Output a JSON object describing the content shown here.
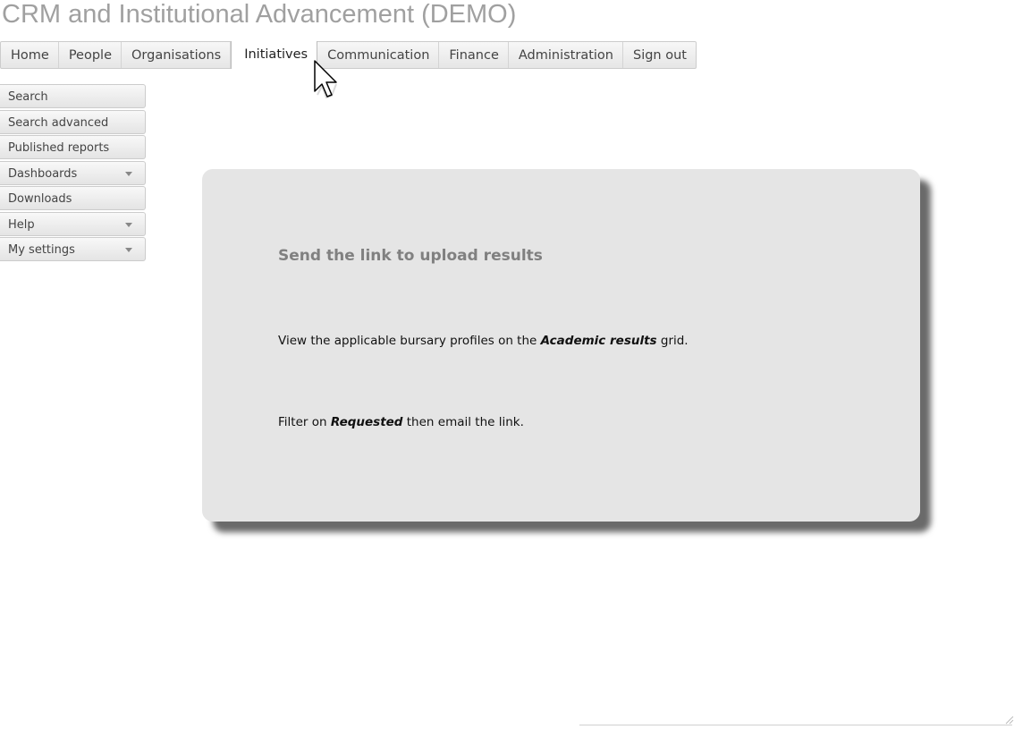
{
  "app": {
    "title": "CRM and Institutional Advancement (DEMO)"
  },
  "topnav": {
    "items": [
      {
        "label": "Home"
      },
      {
        "label": "People"
      },
      {
        "label": "Organisations"
      },
      {
        "label": "Initiatives",
        "active": true
      },
      {
        "label": "Communication"
      },
      {
        "label": "Finance"
      },
      {
        "label": "Administration"
      },
      {
        "label": "Sign out"
      }
    ]
  },
  "sidebar": {
    "items": [
      {
        "label": "Search"
      },
      {
        "label": "Search advanced"
      },
      {
        "label": "Published reports"
      },
      {
        "label": "Dashboards",
        "dropdown": true
      },
      {
        "label": "Downloads"
      },
      {
        "label": "Help",
        "dropdown": true
      },
      {
        "label": "My settings",
        "dropdown": true
      }
    ]
  },
  "panel": {
    "heading": "Send the link to upload results",
    "line1": {
      "before": "View the applicable bursary profiles on the ",
      "emphasis": "Academic results",
      "after": " grid."
    },
    "line2": {
      "before": "Filter on ",
      "emphasis": "Requested",
      "after": " then email the link."
    }
  },
  "colors": {
    "title": "#a0a0a0",
    "panel_bg": "#e5e5e5",
    "panel_heading": "#808080",
    "nav_bg": "#eeeeee"
  },
  "icons": {
    "cursor": "arrow-pointer-icon",
    "dropdown": "caret-down-icon",
    "resize": "resize-grip-icon"
  }
}
